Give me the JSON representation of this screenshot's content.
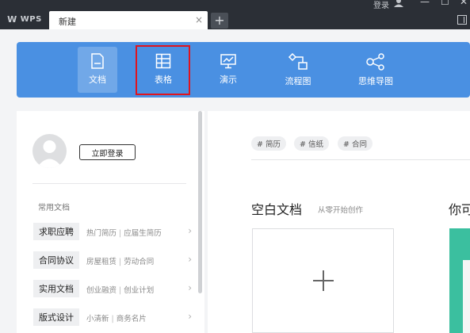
{
  "titlebar": {
    "brand": "WPS",
    "tab_label": "新建",
    "tab_close": "×",
    "new_tab": "+",
    "login": "登录",
    "window_controls": [
      "—",
      "☐",
      "✕"
    ]
  },
  "toolbar": {
    "items": [
      {
        "label": "文档",
        "icon": "document-icon",
        "active": true
      },
      {
        "label": "表格",
        "icon": "table-icon",
        "highlighted": true
      },
      {
        "label": "演示",
        "icon": "presentation-icon"
      },
      {
        "label": "流程图",
        "icon": "flowchart-icon"
      },
      {
        "label": "思维导图",
        "icon": "mindmap-icon"
      }
    ],
    "highlight_color": "#e0141e",
    "bar_color": "#4a90e2"
  },
  "left": {
    "login_button": "立即登录",
    "section_title": "常用文档",
    "rows": [
      {
        "category": "求职应聘",
        "a": "热门简历",
        "b": "应届生简历"
      },
      {
        "category": "合同协议",
        "a": "房屋租赁",
        "b": "劳动合同"
      },
      {
        "category": "实用文档",
        "a": "创业融资",
        "b": "创业计划"
      },
      {
        "category": "版式设计",
        "a": "小清新",
        "b": "商务名片"
      }
    ],
    "separator": "|",
    "chevron": "›"
  },
  "right": {
    "tags": [
      "# 简历",
      "# 信纸",
      "# 合同"
    ],
    "blank_title": "空白文档",
    "blank_subtitle": "从零开始创作",
    "next_title": "你可"
  }
}
